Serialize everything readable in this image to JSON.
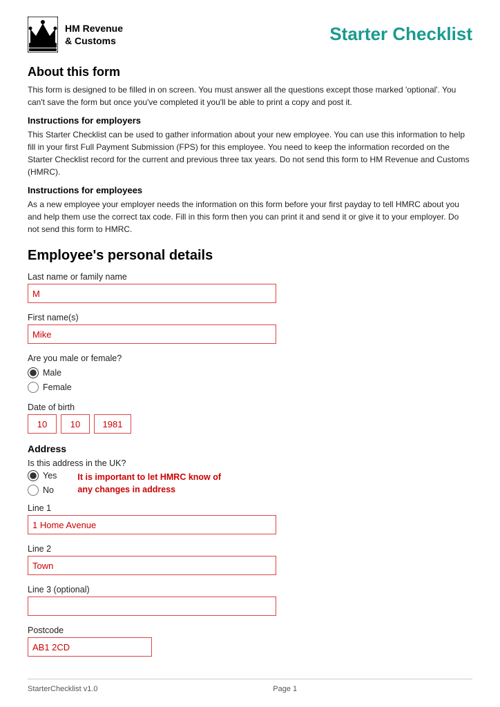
{
  "header": {
    "logo_line1": "HM Revenue",
    "logo_line2": "& Customs",
    "page_title": "Starter Checklist"
  },
  "about": {
    "title": "About this form",
    "intro": "This form is designed to be filled in on screen. You must answer all the questions except those marked 'optional'. You can't save the form but once you've completed it you'll be able to print a copy and post it.",
    "employers_heading": "Instructions for employers",
    "employers_text": "This Starter Checklist can be used to gather information about your new employee. You can use this information to help fill in your first Full Payment Submission (FPS) for this employee. You need to keep the information recorded on the Starter Checklist record for the current and previous three tax years. Do not send this form to HM Revenue and Customs (HMRC).",
    "employees_heading": "Instructions for employees",
    "employees_text": "As a new employee your employer needs the information on this form before your first payday to tell HMRC about you and help them use the correct tax code. Fill in this form then you can print it and send it or give it to your employer. Do not send this form to HMRC."
  },
  "employee_section": {
    "title": "Employee's personal details",
    "last_name_label": "Last name or family name",
    "last_name_value": "M",
    "first_name_label": "First name(s)",
    "first_name_value": "Mike",
    "gender_question": "Are you male or female?",
    "gender_options": [
      "Male",
      "Female"
    ],
    "gender_selected": "Male",
    "dob_label": "Date of birth",
    "dob_day": "10",
    "dob_month": "10",
    "dob_year": "1981"
  },
  "address": {
    "title": "Address",
    "uk_question": "Is this address in the UK?",
    "uk_options": [
      "Yes",
      "No"
    ],
    "uk_selected": "Yes",
    "important_note": "It is important to let HMRC know of any changes in address",
    "line1_label": "Line 1",
    "line1_value": "1 Home Avenue",
    "line2_label": "Line 2",
    "line2_value": "Town",
    "line3_label": "Line 3 (optional)",
    "line3_value": "",
    "postcode_label": "Postcode",
    "postcode_value": "AB1 2CD"
  },
  "footer": {
    "left": "StarterChecklist v1.0",
    "center": "Page 1"
  }
}
